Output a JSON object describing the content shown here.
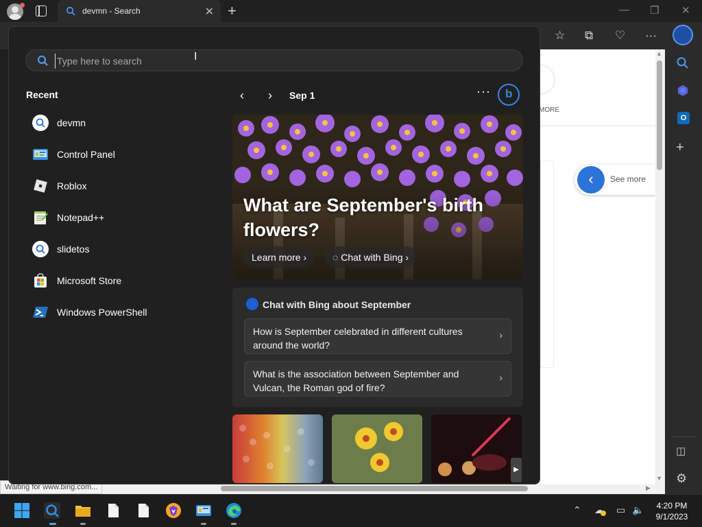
{
  "browser": {
    "tab_title": "devmn - Search"
  },
  "webpage": {
    "more_label": "MORE",
    "see_more_label": "See more"
  },
  "status_text": "Waiting for www.bing.com...",
  "search": {
    "placeholder": "Type here to search"
  },
  "recent": {
    "title": "Recent",
    "items": [
      {
        "label": "devmn",
        "icon": "search-icon"
      },
      {
        "label": "Control Panel",
        "icon": "control-panel-icon"
      },
      {
        "label": "Roblox",
        "icon": "roblox-icon"
      },
      {
        "label": "Notepad++",
        "icon": "notepad-plus-plus-icon"
      },
      {
        "label": "slidetos",
        "icon": "search-icon"
      },
      {
        "label": "Microsoft Store",
        "icon": "microsoft-store-icon"
      },
      {
        "label": "Windows PowerShell",
        "icon": "powershell-icon"
      }
    ]
  },
  "highlights": {
    "date": "Sep 1",
    "hero_title": "What are September's birth flowers?",
    "learn_more": "Learn more",
    "chat_with_bing": "Chat with Bing"
  },
  "chat": {
    "title": "Chat with Bing about September",
    "questions": [
      "How is September celebrated in different cultures around the world?",
      "What is the association between September and Vulcan, the Roman god of fire?"
    ]
  },
  "clock": {
    "time": "4:20 PM",
    "date": "9/1/2023"
  },
  "colors": {
    "accent": "#3a85e8",
    "flyout_bg": "#202020",
    "card_bg": "#2b2b2b"
  }
}
